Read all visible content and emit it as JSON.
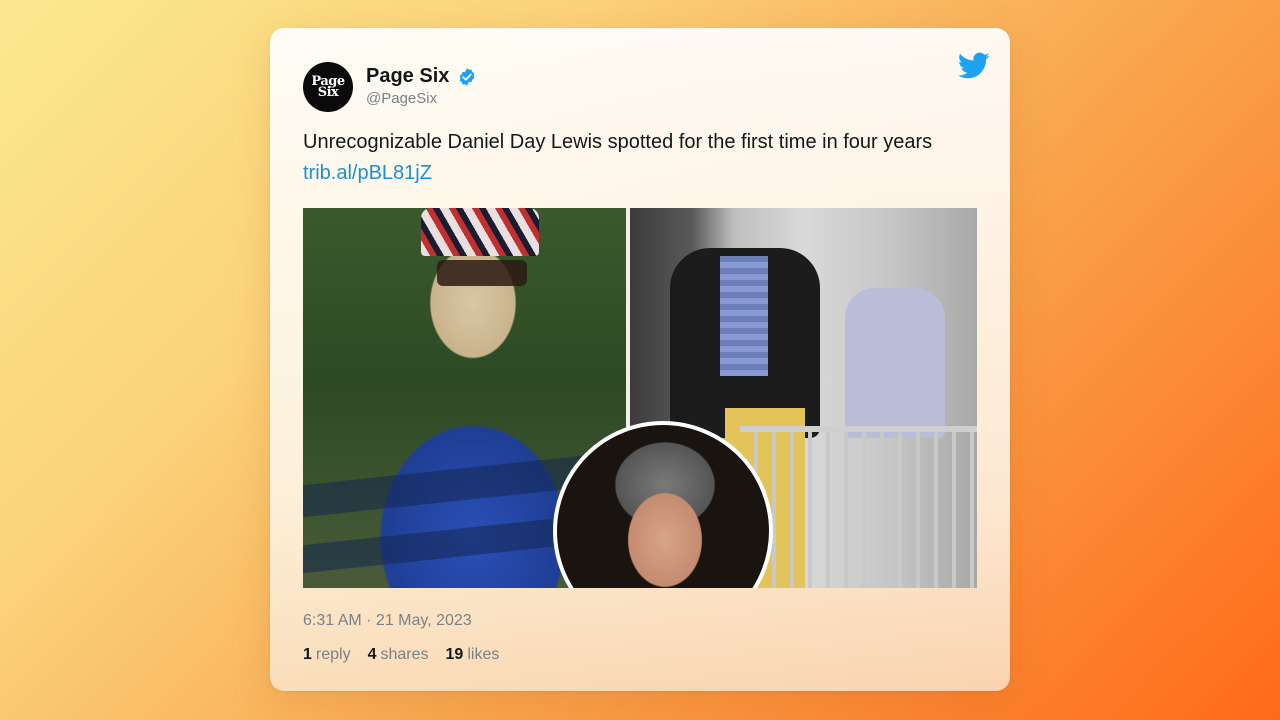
{
  "tweet": {
    "author_name": "Page Six",
    "author_handle": "@PageSix",
    "avatar_line1": "Page",
    "avatar_line2": "Six",
    "text": "Unrecognizable Daniel Day Lewis spotted for the first time in four years",
    "link": "trib.al/pBL81jZ",
    "timestamp": "6:31 AM · 21 May, 2023",
    "stats": {
      "replies_count": "1",
      "replies_label": "reply",
      "shares_count": "4",
      "shares_label": "shares",
      "likes_count": "19",
      "likes_label": "likes"
    }
  },
  "icons": {
    "verified": "verified-badge-icon",
    "brand": "twitter-bird-icon"
  },
  "colors": {
    "link": "#1d8fd6",
    "verified": "#1da1f2",
    "bird": "#1da1f2",
    "background_start": "#fbe98f",
    "background_end": "#ff6a1a"
  }
}
